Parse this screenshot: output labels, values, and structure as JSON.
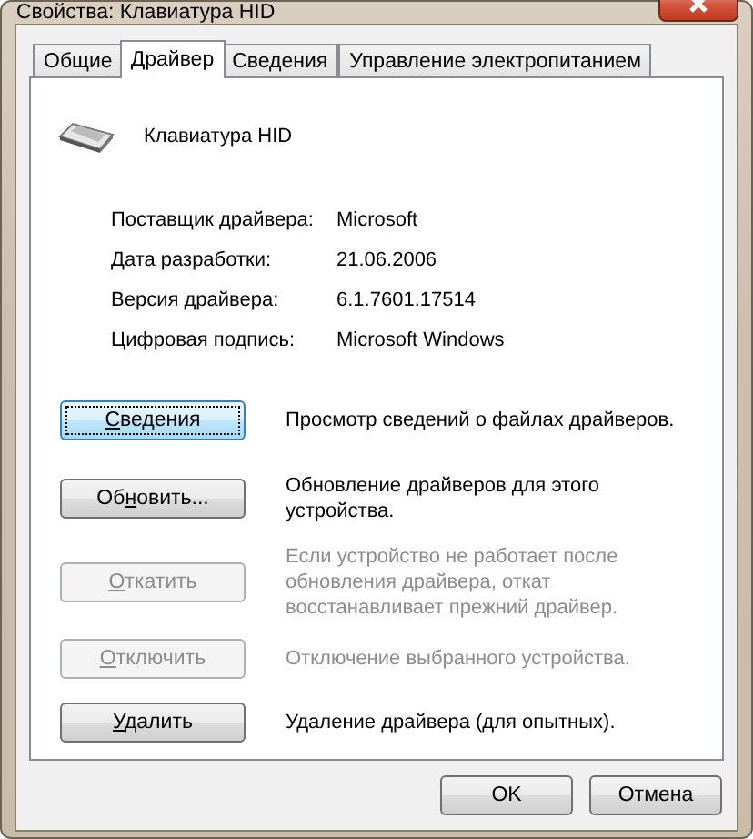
{
  "window": {
    "title": "Свойства: Клавиатура HID"
  },
  "tabs": [
    {
      "label": "Общие",
      "selected": false
    },
    {
      "label": "Драйвер",
      "selected": true
    },
    {
      "label": "Сведения",
      "selected": false
    },
    {
      "label": "Управление электропитанием",
      "selected": false
    }
  ],
  "device": {
    "name": "Клавиатура HID"
  },
  "properties": [
    {
      "label": "Поставщик драйвера:",
      "value": "Microsoft"
    },
    {
      "label": "Дата разработки:",
      "value": "21.06.2006"
    },
    {
      "label": "Версия драйвера:",
      "value": "6.1.7601.17514"
    },
    {
      "label": "Цифровая подпись:",
      "value": "Microsoft Windows"
    }
  ],
  "actions": [
    {
      "label": {
        "key": "С",
        "after": "ведения"
      },
      "disabled": false,
      "focused": true,
      "description": "Просмотр сведений о файлах драйверов."
    },
    {
      "label": {
        "before": "Об",
        "key": "н",
        "after": "овить..."
      },
      "disabled": false,
      "focused": false,
      "description": "Обновление драйверов для этого устройства."
    },
    {
      "label": {
        "key": "О",
        "after": "ткатить"
      },
      "disabled": true,
      "focused": false,
      "description": "Если устройство не работает после обновления драйвера, откат восстанавливает прежний драйвер."
    },
    {
      "label": {
        "key": "О",
        "after": "тключить"
      },
      "disabled": true,
      "focused": false,
      "description": "Отключение выбранного устройства."
    },
    {
      "label": {
        "key": "У",
        "after": "далить"
      },
      "disabled": false,
      "focused": false,
      "description": "Удаление драйвера (для опытных)."
    }
  ],
  "footer_buttons": [
    "OK",
    "Отмена"
  ]
}
